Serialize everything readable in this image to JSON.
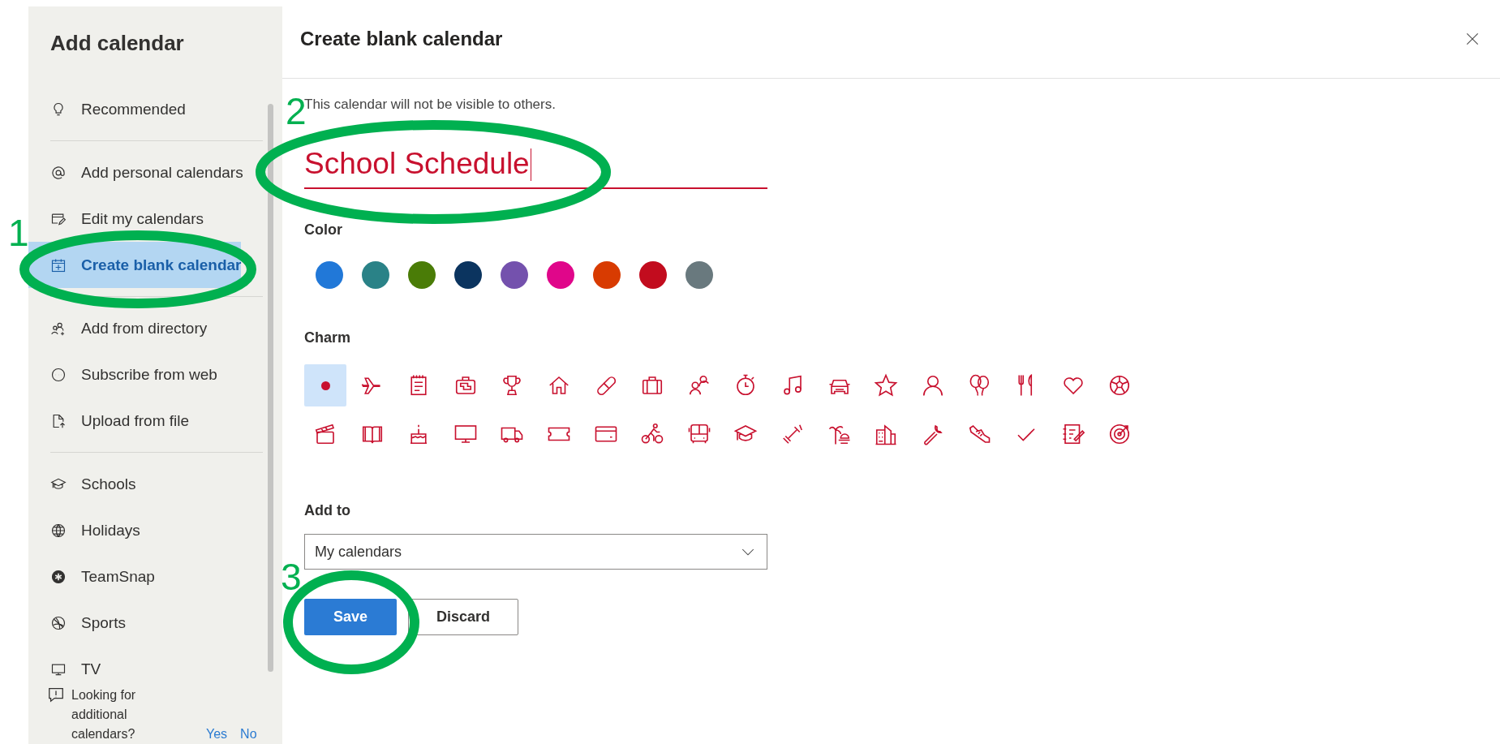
{
  "sidebar": {
    "title": "Add calendar",
    "groups": [
      [
        {
          "label": "Recommended",
          "selected": false
        }
      ],
      [
        {
          "label": "Add personal calendars",
          "selected": false
        },
        {
          "label": "Edit my calendars",
          "selected": false
        },
        {
          "label": "Create blank calendar",
          "selected": true
        }
      ],
      [
        {
          "label": "Add from directory",
          "selected": false
        },
        {
          "label": "Subscribe from web",
          "selected": false
        },
        {
          "label": "Upload from file",
          "selected": false
        }
      ],
      [
        {
          "label": "Schools",
          "selected": false
        },
        {
          "label": "Holidays",
          "selected": false
        },
        {
          "label": "TeamSnap",
          "selected": false
        },
        {
          "label": "Sports",
          "selected": false
        },
        {
          "label": "TV",
          "selected": false
        }
      ]
    ],
    "footer": {
      "text": "Looking for additional calendars?",
      "links": [
        "Yes",
        "No"
      ]
    }
  },
  "panel": {
    "title": "Create blank calendar",
    "notice": "This calendar will not be visible to others.",
    "name_value": "School Schedule",
    "color_label": "Color",
    "colors": [
      {
        "color": "#2178d8"
      },
      {
        "color": "#2a8287"
      },
      {
        "color": "#4a7c07"
      },
      {
        "color": "#0b345f"
      },
      {
        "color": "#7451ad"
      },
      {
        "color": "#e0068a"
      },
      {
        "color": "#d83b01"
      },
      {
        "color": "#c20c1e"
      },
      {
        "color": "#69797e"
      }
    ],
    "charm_label": "Charm",
    "charms": [
      {
        "selected": true
      },
      {
        "selected": false
      },
      {
        "selected": false
      },
      {
        "selected": false
      },
      {
        "selected": false
      },
      {
        "selected": false
      },
      {
        "selected": false
      },
      {
        "selected": false
      },
      {
        "selected": false
      },
      {
        "selected": false
      },
      {
        "selected": false
      },
      {
        "selected": false
      },
      {
        "selected": false
      },
      {
        "selected": false
      },
      {
        "selected": false
      },
      {
        "selected": false
      },
      {
        "selected": false
      },
      {
        "selected": false
      },
      {
        "selected": false
      },
      {
        "selected": false
      },
      {
        "selected": false
      },
      {
        "selected": false
      },
      {
        "selected": false
      },
      {
        "selected": false
      },
      {
        "selected": false
      },
      {
        "selected": false
      },
      {
        "selected": false
      },
      {
        "selected": false
      },
      {
        "selected": false
      },
      {
        "selected": false
      },
      {
        "selected": false
      },
      {
        "selected": false
      },
      {
        "selected": false
      },
      {
        "selected": false
      },
      {
        "selected": false
      },
      {
        "selected": false
      }
    ],
    "add_to_label": "Add to",
    "add_to_value": "My calendars",
    "buttons": [
      {
        "label": "Save",
        "kind": "primary"
      },
      {
        "label": "Discard",
        "kind": "secondary"
      }
    ]
  },
  "annotations": [
    "1",
    "2",
    "3"
  ]
}
